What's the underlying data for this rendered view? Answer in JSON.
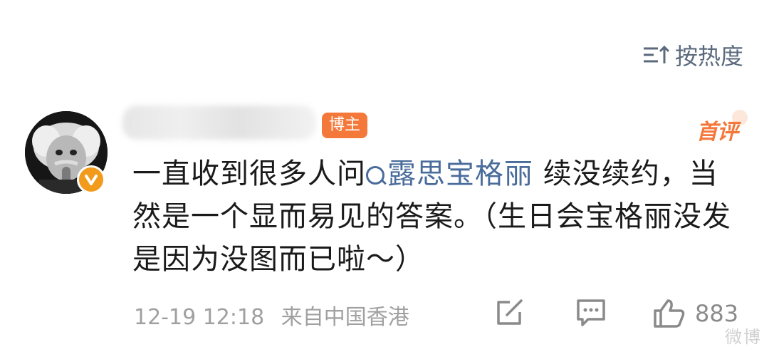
{
  "sort": {
    "label": "按热度",
    "icon": "sort-icon"
  },
  "comment": {
    "author_badge": "博主",
    "first_badge": "首评",
    "text_before": "一直收到很多人问",
    "topic": "露思宝格丽",
    "text_after": " 续没续约，当然是一个显而易见的答案。（生日会宝格丽没发是因为没图而已啦～）",
    "date": "12-19 12:18",
    "location": "来自中国香港",
    "like_count": "883"
  },
  "colors": {
    "accent_orange": "#f4783a",
    "link_blue": "#4a6c9b",
    "meta_gray": "#a0a0a0"
  },
  "watermark": "微博"
}
